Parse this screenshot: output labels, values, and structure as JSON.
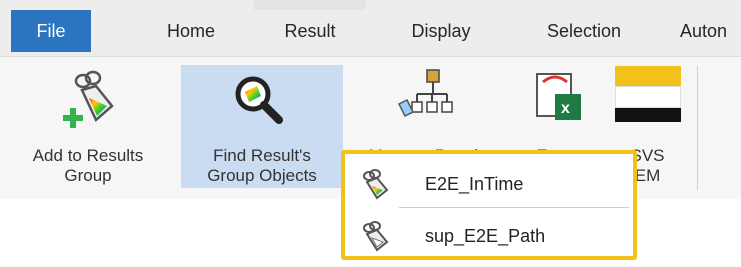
{
  "tabs": {
    "file": "File",
    "home": "Home",
    "result": "Result",
    "display": "Display",
    "selection": "Selection",
    "automation": "Auton"
  },
  "ribbon": {
    "add_to_results_group": [
      "Add to Results",
      "Group"
    ],
    "find_results_group_objects": [
      "Find Result's",
      "Group Objects"
    ],
    "manage_results": "Manage Results",
    "export": "Export",
    "svs": [
      "SVS",
      "EM"
    ]
  },
  "dropdown": {
    "items": [
      {
        "label": "E2E_InTime",
        "icon": "tag-group-icon"
      },
      {
        "label": "sup_E2E_Path",
        "icon": "tag-group-icon"
      }
    ]
  },
  "colors": {
    "file_tab": "#2b74bf",
    "highlight": "#c9dcf1",
    "popup_border": "#f2c21b",
    "plus_green": "#31b54a"
  }
}
